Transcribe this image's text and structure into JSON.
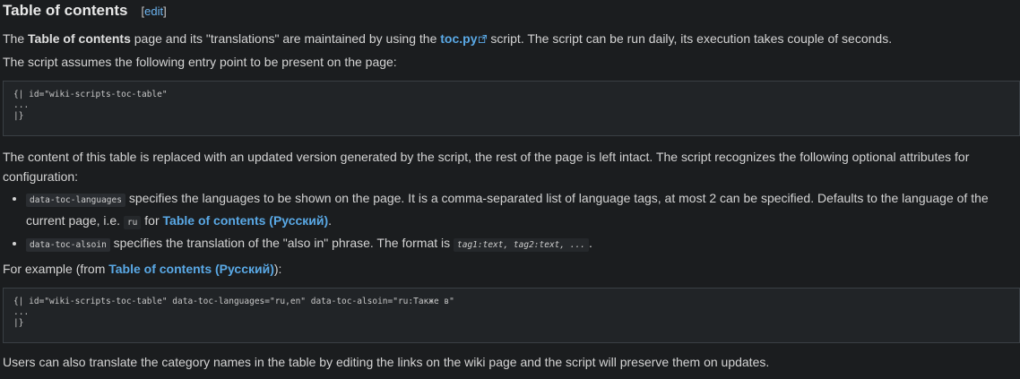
{
  "heading": {
    "title": "Table of contents",
    "edit_open": "[",
    "edit_label": "edit",
    "edit_close": "]"
  },
  "para1": {
    "t1": "The ",
    "bold": "Table of contents",
    "t2": " page and its \"translations\" are maintained by using the ",
    "link": "toc.py",
    "t3": " script. The script can be run daily, its execution takes couple of seconds."
  },
  "para2": "The script assumes the following entry point to be present on the page:",
  "code1": [
    "{| id=\"wiki-scripts-toc-table\"",
    "...",
    "|}"
  ],
  "para3": "The content of this table is replaced with an updated version generated by the script, the rest of the page is left intact. The script recognizes the following optional attributes for configuration:",
  "list": {
    "item1": {
      "code": "data-toc-languages",
      "t1": " specifies the languages to be shown on the page. It is a comma-separated list of language tags, at most 2 can be specified. Defaults to the language of the current page, i.e. ",
      "code2": "ru",
      "t2": " for ",
      "link": "Table of contents (Русский)",
      "t3": "."
    },
    "item2": {
      "code": "data-toc-alsoin",
      "t1": " specifies the translation of the \"also in\" phrase. The format is ",
      "code2": "tag1:text, tag2:text, ...",
      "t2": "."
    }
  },
  "para4": {
    "t1": "For example (from ",
    "link": "Table of contents (Русский)",
    "t2": "):"
  },
  "code2": [
    "{| id=\"wiki-scripts-toc-table\" data-toc-languages=\"ru,en\" data-toc-alsoin=\"ru:Также в\"",
    "...",
    "|}"
  ],
  "para5": "Users can also translate the category names in the table by editing the links on the wiki page and the script will preserve them on updates."
}
